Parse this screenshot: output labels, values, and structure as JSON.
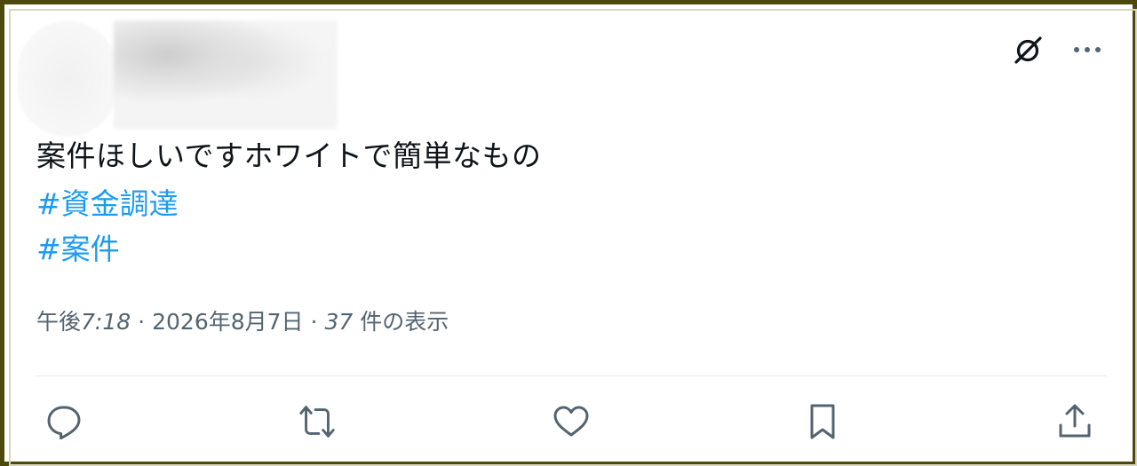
{
  "post": {
    "text": "案件ほしいですホワイトで簡単なもの",
    "hashtags": [
      "#資金調達",
      "#案件"
    ],
    "time_prefix": "午後",
    "time": "7:18",
    "separator": "·",
    "date": "2026年8月7日",
    "views_count": "37",
    "views_label": " 件の表示"
  },
  "icons": {
    "grok": "grok-icon",
    "more": "more-icon",
    "reply": "reply-icon",
    "repost": "repost-icon",
    "like": "like-icon",
    "bookmark": "bookmark-icon",
    "share": "share-icon"
  },
  "colors": {
    "text": "#0f1419",
    "link": "#1d9bf0",
    "secondary": "#536471",
    "frame": "#4b4a0c"
  }
}
